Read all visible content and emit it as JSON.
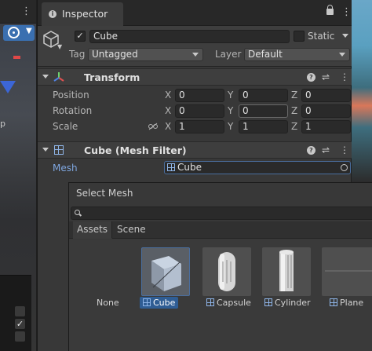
{
  "scene": {
    "label_fragment": "p"
  },
  "inspector": {
    "tab_label": "Inspector",
    "object": {
      "name": "Cube",
      "active": true,
      "static_label": "Static",
      "static": false,
      "tag_label": "Tag",
      "tag_value": "Untagged",
      "layer_label": "Layer",
      "layer_value": "Default"
    },
    "transform": {
      "title": "Transform",
      "position_label": "Position",
      "rotation_label": "Rotation",
      "scale_label": "Scale",
      "position": {
        "x": "0",
        "y": "0",
        "z": "0"
      },
      "rotation": {
        "x": "0",
        "y": "0",
        "z": "0"
      },
      "scale": {
        "x": "1",
        "y": "1",
        "z": "1"
      },
      "axis_x": "X",
      "axis_y": "Y",
      "axis_z": "Z"
    },
    "mesh_filter": {
      "title": "Cube (Mesh Filter)",
      "mesh_label": "Mesh",
      "mesh_value": "Cube"
    }
  },
  "picker": {
    "title": "Select Mesh",
    "search_value": "",
    "tabs": [
      "Assets",
      "Scene"
    ],
    "active_tab": "Assets",
    "items": [
      {
        "label": "None",
        "icon": "",
        "selected": false
      },
      {
        "label": "Cube",
        "icon": "mesh-icon",
        "selected": true
      },
      {
        "label": "Capsule",
        "icon": "mesh-icon",
        "selected": false
      },
      {
        "label": "Cylinder",
        "icon": "mesh-icon",
        "selected": false
      },
      {
        "label": "Plane",
        "icon": "mesh-icon",
        "selected": false
      }
    ]
  },
  "colors": {
    "selection": "#2f5d94",
    "mesh_label_accent": "#7fa7e0",
    "scene_tool_active": "#3a6fb0"
  }
}
